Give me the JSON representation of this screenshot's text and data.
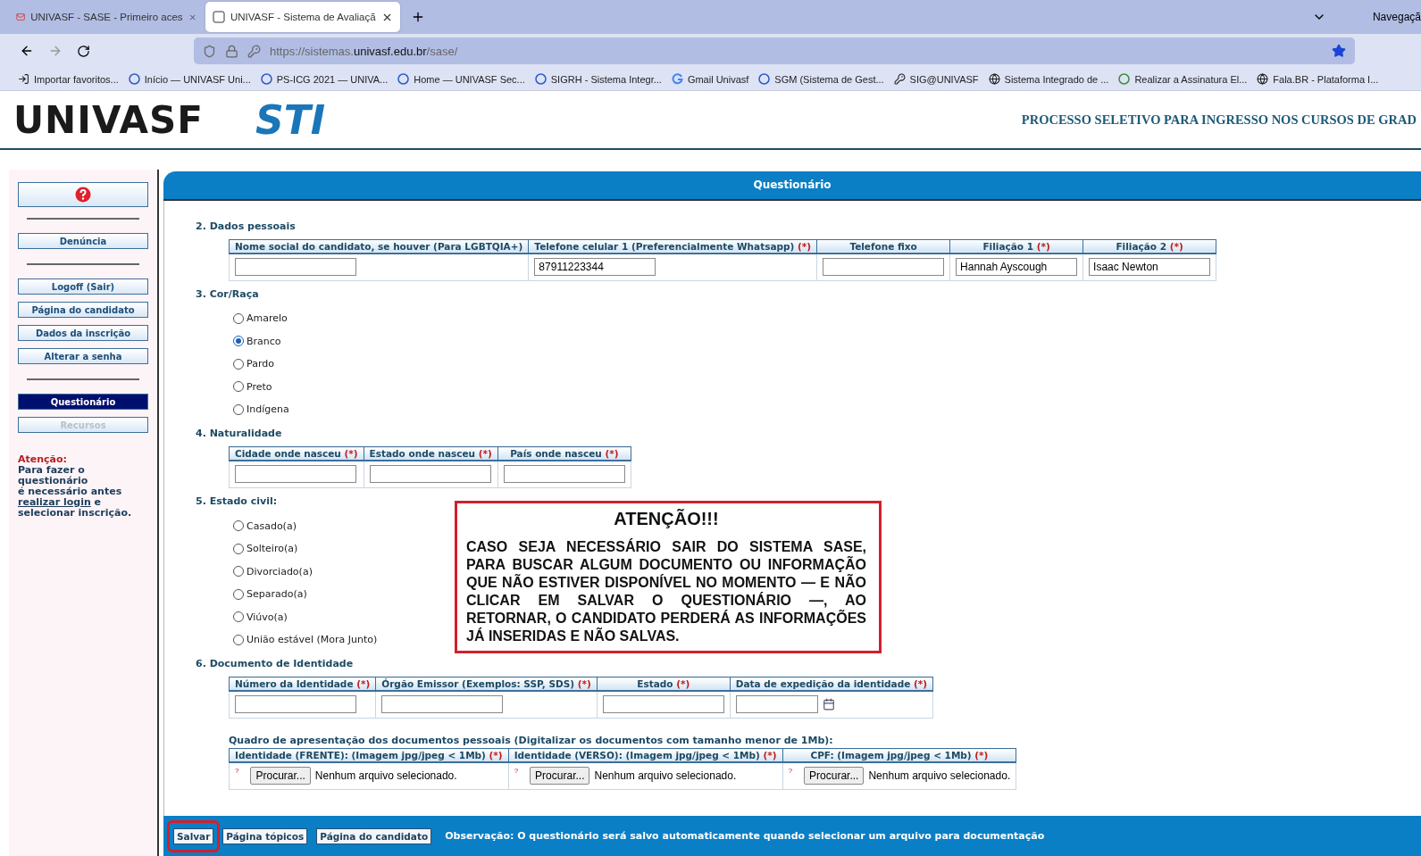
{
  "browser": {
    "tabs": [
      {
        "title": "UNIVASF - SASE - Primeiro aces",
        "selected": false
      },
      {
        "title": "UNIVASF - Sistema de Avaliaçã",
        "selected": true
      }
    ],
    "url_prefix": "https://sistemas.",
    "url_domain": "univasf.edu.br",
    "url_path": "/sase/",
    "private_label": "Navegaçã",
    "bookmarks": [
      {
        "label": "Importar favoritos..."
      },
      {
        "label": "Início — UNIVASF Uni..."
      },
      {
        "label": "PS-ICG 2021 — UNIVA..."
      },
      {
        "label": "Home — UNIVASF Sec..."
      },
      {
        "label": "SIGRH - Sistema Integr..."
      },
      {
        "label": "Gmail Univasf"
      },
      {
        "label": "SGM (Sistema de Gest..."
      },
      {
        "label": "SIG@UNIVASF"
      },
      {
        "label": "Sistema Integrado de ..."
      },
      {
        "label": "Realizar a Assinatura El..."
      },
      {
        "label": "Fala.BR - Plataforma I..."
      }
    ]
  },
  "header": {
    "logo": "UNIVASF",
    "logo2": "STI",
    "title": "PROCESSO SELETIVO PARA INGRESSO NOS CURSOS DE GRAD"
  },
  "sidebar": {
    "items": [
      {
        "kind": "help"
      },
      {
        "kind": "divider"
      },
      {
        "kind": "link",
        "label": "Denúncia",
        "selected": false,
        "disabled": false
      },
      {
        "kind": "divider"
      },
      {
        "kind": "link",
        "label": "Logoff (Sair)",
        "selected": false,
        "disabled": false
      },
      {
        "kind": "link",
        "label": "Página do candidato",
        "selected": false,
        "disabled": false
      },
      {
        "kind": "link",
        "label": "Dados da inscrição",
        "selected": false,
        "disabled": false
      },
      {
        "kind": "link",
        "label": "Alterar a senha",
        "selected": false,
        "disabled": false
      },
      {
        "kind": "divider"
      },
      {
        "kind": "link",
        "label": "Questionário",
        "selected": true,
        "disabled": false
      },
      {
        "kind": "link",
        "label": "Recursos",
        "selected": false,
        "disabled": true
      }
    ],
    "notice": {
      "title": "Atenção:",
      "lines": [
        "Para fazer o",
        "questionário",
        "é necessário antes"
      ],
      "link": "realizar login",
      "after": "e",
      "last": "selecionar inscrição."
    }
  },
  "panel": {
    "title": "Questionário",
    "sections": [
      {
        "kind": "table",
        "title": "2. Dados pessoais",
        "columns": [
          {
            "label": "Nome social do candidato, se houver (Para LGBTQIA+)"
          },
          {
            "label": "Telefone celular 1 (Preferencialmente Whatsapp)",
            "mark": "(*)"
          },
          {
            "label": "Telefone fixo"
          },
          {
            "label": "Filiação 1",
            "mark": "(*)"
          },
          {
            "label": "Filiação 2",
            "mark": "(*)"
          }
        ],
        "cells": [
          {
            "kind": "text"
          },
          {
            "kind": "text",
            "value": "87911223344"
          },
          {
            "kind": "text"
          },
          {
            "kind": "text",
            "value": "Hannah Ayscough"
          },
          {
            "kind": "text",
            "value": "Isaac Newton"
          }
        ]
      },
      {
        "kind": "radios",
        "title": "3. Cor/Raça",
        "options": [
          {
            "label": "Amarelo",
            "selected": false
          },
          {
            "label": "Branco",
            "selected": true
          },
          {
            "label": "Pardo",
            "selected": false
          },
          {
            "label": "Preto",
            "selected": false
          },
          {
            "label": "Indígena",
            "selected": false
          }
        ]
      },
      {
        "kind": "table",
        "title": "4. Naturalidade",
        "columns": [
          {
            "label": "Cidade onde nasceu",
            "mark": "(*)"
          },
          {
            "label": "Estado onde nasceu",
            "mark": "(*)"
          },
          {
            "label": "País onde nasceu",
            "mark": "(*)"
          }
        ],
        "cells": [
          {
            "kind": "text"
          },
          {
            "kind": "text"
          },
          {
            "kind": "text"
          }
        ]
      },
      {
        "kind": "radios",
        "title": "5. Estado civil:",
        "options": [
          {
            "label": "Casado(a)",
            "selected": false
          },
          {
            "label": "Solteiro(a)",
            "selected": false
          },
          {
            "label": "Divorciado(a)",
            "selected": false
          },
          {
            "label": "Separado(a)",
            "selected": false
          },
          {
            "label": "Viúvo(a)",
            "selected": false
          },
          {
            "label": "União estável (Mora Junto)",
            "selected": false
          }
        ]
      },
      {
        "kind": "table",
        "title": "6. Documento de Identidade",
        "columns": [
          {
            "label": "Número da Identidade",
            "mark": "(*)"
          },
          {
            "label": "Órgão Emissor (Exemplos: SSP, SDS)",
            "mark": "(*)"
          },
          {
            "label": "Estado",
            "mark": "(*)"
          },
          {
            "label": "Data de expedição da identidade",
            "mark": "(*)"
          }
        ],
        "cells": [
          {
            "kind": "text"
          },
          {
            "kind": "text"
          },
          {
            "kind": "text"
          },
          {
            "kind": "date"
          }
        ]
      },
      {
        "kind": "table",
        "caption": "Quadro de apresentação dos documentos pessoais (Digitalizar os documentos com tamanho menor de 1Mb):",
        "columns": [
          {
            "label": "Identidade (FRENTE): (Imagem jpg/jpeg < 1Mb)",
            "mark": "(*)"
          },
          {
            "label": "Identidade (VERSO): (Imagem jpg/jpeg < 1Mb)",
            "mark": "(*)"
          },
          {
            "label": "CPF: (Imagem jpg/jpeg < 1Mb)",
            "mark": "(*)"
          }
        ],
        "cells": [
          {
            "kind": "file",
            "hint": "?",
            "button": "Procurar...",
            "value": "Nenhum arquivo selecionado."
          },
          {
            "kind": "file",
            "hint": "?",
            "button": "Procurar...",
            "value": "Nenhum arquivo selecionado."
          },
          {
            "kind": "file",
            "hint": "?",
            "button": "Procurar...",
            "value": "Nenhum arquivo selecionado."
          }
        ]
      }
    ],
    "alert": {
      "title": "ATENÇÃO!!!",
      "text": "CASO SEJA NECESSÁRIO SAIR DO SISTEMA SASE, PARA BUSCAR ALGUM DOCUMENTO OU INFORMAÇÃO QUE NÃO ESTIVER DISPONÍVEL NO MOMENTO — E NÃO CLICAR EM SALVAR O QUESTIONÁRIO —, AO RETORNAR, O CANDIDATO PERDERÁ AS INFORMAÇÕES JÁ INSERIDAS E NÃO SALVAS."
    },
    "footer": {
      "buttons": [
        {
          "label": "Salvar",
          "highlighted": true
        },
        {
          "label": "Página tópicos",
          "highlighted": false
        },
        {
          "label": "Página do candidato",
          "highlighted": false
        }
      ],
      "note": "Observação: O questionário será salvo automaticamente quando selecionar um arquivo para documentação"
    }
  }
}
